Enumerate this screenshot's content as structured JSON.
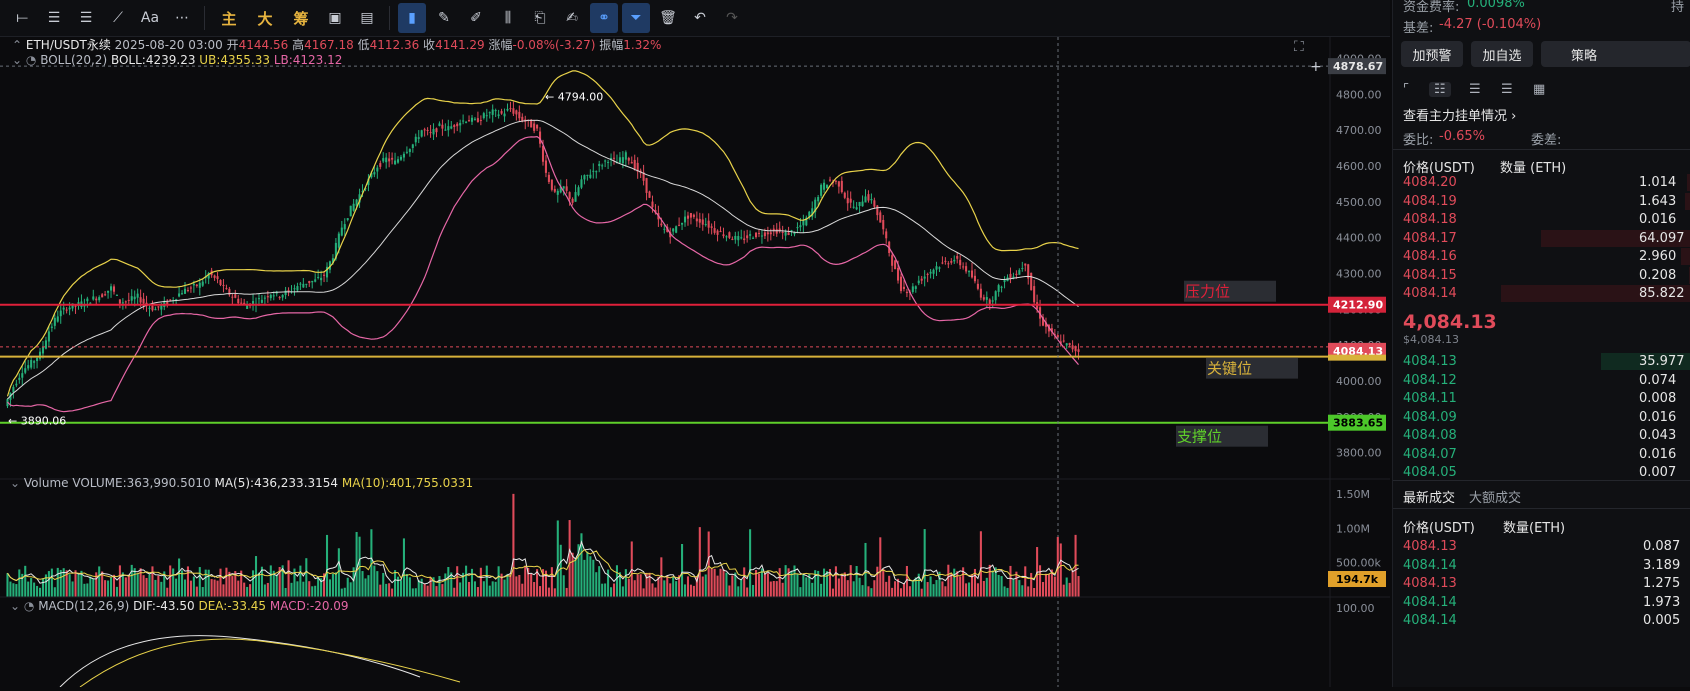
{
  "toolbar": {
    "items": [
      {
        "name": "horizontal-line-icon",
        "glyph": "⟝",
        "active": false
      },
      {
        "name": "horizontal-ray-icon",
        "glyph": "☰",
        "active": false
      },
      {
        "name": "parallel-channel-icon",
        "glyph": "☰",
        "active": false
      },
      {
        "name": "trend-line-icon",
        "glyph": "⟋",
        "active": false
      },
      {
        "name": "text-tool-icon",
        "glyph": "Aa",
        "active": false
      },
      {
        "name": "more-tools-icon",
        "glyph": "⋯",
        "active": false
      }
    ],
    "cn_buttons": [
      "主",
      "大",
      "筹"
    ],
    "right_items": [
      {
        "name": "magnet-icon",
        "glyph": "▣",
        "active": false
      },
      {
        "name": "template-icon",
        "glyph": "▤",
        "active": false
      },
      {
        "name": "bookmark-icon",
        "glyph": "▮",
        "active": true
      },
      {
        "name": "ruler-icon",
        "glyph": "✎",
        "active": false
      },
      {
        "name": "pen-icon",
        "glyph": "✐",
        "active": false
      },
      {
        "name": "candles-icon",
        "glyph": "⫼",
        "active": false
      },
      {
        "name": "clipboard-icon",
        "glyph": "⎗",
        "active": false
      },
      {
        "name": "note-icon",
        "glyph": "✍",
        "active": false
      },
      {
        "name": "link-icon",
        "glyph": "⚭",
        "active": true
      },
      {
        "name": "filter-icon",
        "glyph": "⏷",
        "active": true
      },
      {
        "name": "trash-icon",
        "glyph": "🗑",
        "active": false
      },
      {
        "name": "undo-icon",
        "glyph": "↶",
        "active": false
      },
      {
        "name": "redo-icon",
        "glyph": "↷",
        "active": false
      }
    ]
  },
  "header": {
    "symbol": "ETH/USDT永续",
    "datetime": "2025-08-20 03:00",
    "open_label": "开",
    "open": "4144.56",
    "high_label": "高",
    "high": "4167.18",
    "low_label": "低",
    "low": "4112.36",
    "close_label": "收",
    "close": "4141.29",
    "change_label": "涨幅",
    "change": "-0.08%(-3.27)",
    "amp_label": "振幅",
    "amp": "1.32%"
  },
  "boll": {
    "label": "BOLL(20,2)",
    "mid": "BOLL:4239.23",
    "ub": "UB:4355.33",
    "lb": "LB:4123.12"
  },
  "volume": {
    "label": "Volume",
    "vol": "VOLUME:363,990.5010",
    "ma5": "MA(5):436,233.3154",
    "ma10": "MA(10):401,755.0331"
  },
  "macd": {
    "label": "MACD(12,26,9)",
    "dif": "DIF:-43.50",
    "dea": "DEA:-33.45",
    "macd": "MACD:-20.09"
  },
  "price_axis": [
    "4900.00",
    "4800.00",
    "4700.00",
    "4600.00",
    "4500.00",
    "4400.00",
    "4300.00",
    "4200.00",
    "4100.00",
    "4000.00",
    "3900.00",
    "3800.00"
  ],
  "vol_axis": [
    "1.50M",
    "1.00M",
    "500.00k"
  ],
  "macd_axis": [
    "100.00"
  ],
  "price_tags": {
    "top": "4878.67",
    "resistance": "4212.90",
    "current": "4084.13",
    "support": "3883.65",
    "volume": "194.7k"
  },
  "annotations": {
    "resistance": "压力位",
    "key": "关键位",
    "support": "支撑位",
    "high_marker": "4794.00",
    "low_marker": "3890.06"
  },
  "colors": {
    "up": "#25b07a",
    "down": "#e04b5a",
    "boll_up": "#e8d24a",
    "boll_mid": "#d9d9d9",
    "boll_low": "#e667a6",
    "resistance": "#e0203a",
    "key": "#d8b23a",
    "support": "#5fd02a"
  },
  "chart_data": {
    "type": "candlestick",
    "y_range": [
      3760,
      4960
    ],
    "horizontal_lines": [
      {
        "label": "压力位",
        "value": 4212.9
      },
      {
        "label": "关键位",
        "value": 4068
      },
      {
        "label": "支撑位",
        "value": 3883.65
      }
    ],
    "close_path": [
      3930,
      3985,
      4030,
      4050,
      4075,
      4140,
      4185,
      4205,
      4210,
      4220,
      4230,
      4240,
      4260,
      4220,
      4225,
      4235,
      4210,
      4200,
      4215,
      4230,
      4250,
      4260,
      4270,
      4300,
      4280,
      4250,
      4230,
      4210,
      4220,
      4230,
      4245,
      4240,
      4250,
      4265,
      4275,
      4280,
      4295,
      4350,
      4430,
      4480,
      4520,
      4560,
      4600,
      4620,
      4610,
      4640,
      4660,
      4700,
      4690,
      4710,
      4705,
      4720,
      4730,
      4725,
      4740,
      4750,
      4745,
      4760,
      4735,
      4720,
      4700,
      4580,
      4520,
      4540,
      4500,
      4560,
      4580,
      4600,
      4620,
      4610,
      4630,
      4600,
      4560,
      4480,
      4430,
      4410,
      4440,
      4460,
      4450,
      4440,
      4420,
      4410,
      4400,
      4395,
      4405,
      4410,
      4415,
      4420,
      4410,
      4420,
      4440,
      4480,
      4540,
      4560,
      4550,
      4500,
      4480,
      4520,
      4490,
      4420,
      4330,
      4260,
      4250,
      4280,
      4300,
      4320,
      4330,
      4340,
      4320,
      4290,
      4240,
      4220,
      4260,
      4290,
      4300,
      4330,
      4220,
      4160,
      4130,
      4110,
      4095,
      4084
    ]
  },
  "right_panel": {
    "funding_label": "资金费率:",
    "funding": "0.0098%",
    "hold_label": "持",
    "basis_label": "基差:",
    "basis": "-4.27 (-0.104%)",
    "btn_alert": "加预警",
    "btn_watch": "加自选",
    "btn_strategy": "策略",
    "main_orders": "查看主力挂单情况 ›",
    "ratio_label": "委比:",
    "ratio": "-0.65%",
    "diff_label": "委差:",
    "col_price": "价格(USDT)",
    "col_qty": "数量 (ETH)",
    "asks": [
      {
        "p": "4084.20",
        "q": "1.014",
        "w": 0.02
      },
      {
        "p": "4084.19",
        "q": "1.643",
        "w": 0.03
      },
      {
        "p": "4084.18",
        "q": "0.016",
        "w": 0.0
      },
      {
        "p": "4084.17",
        "q": "64.097",
        "w": 0.75
      },
      {
        "p": "4084.16",
        "q": "2.960",
        "w": 0.05
      },
      {
        "p": "4084.15",
        "q": "0.208",
        "w": 0.01
      },
      {
        "p": "4084.14",
        "q": "85.822",
        "w": 0.95
      }
    ],
    "last_price": "4,084.13",
    "last_usd": "$4,084.13",
    "bids": [
      {
        "p": "4084.13",
        "q": "35.977",
        "w": 0.45
      },
      {
        "p": "4084.12",
        "q": "0.074",
        "w": 0.0
      },
      {
        "p": "4084.11",
        "q": "0.008",
        "w": 0.0
      },
      {
        "p": "4084.09",
        "q": "0.016",
        "w": 0.0
      },
      {
        "p": "4084.08",
        "q": "0.043",
        "w": 0.0
      },
      {
        "p": "4084.07",
        "q": "0.016",
        "w": 0.0
      },
      {
        "p": "4084.05",
        "q": "0.007",
        "w": 0.0
      }
    ],
    "tab_latest": "最新成交",
    "tab_big": "大额成交",
    "trade_col_price": "价格(USDT)",
    "trade_col_qty": "数量(ETH)",
    "trades": [
      {
        "p": "4084.13",
        "q": "0.087",
        "side": "down"
      },
      {
        "p": "4084.14",
        "q": "3.189",
        "side": "up"
      },
      {
        "p": "4084.13",
        "q": "1.275",
        "side": "down"
      },
      {
        "p": "4084.14",
        "q": "1.973",
        "side": "up"
      },
      {
        "p": "4084.14",
        "q": "0.005",
        "side": "up"
      }
    ]
  }
}
